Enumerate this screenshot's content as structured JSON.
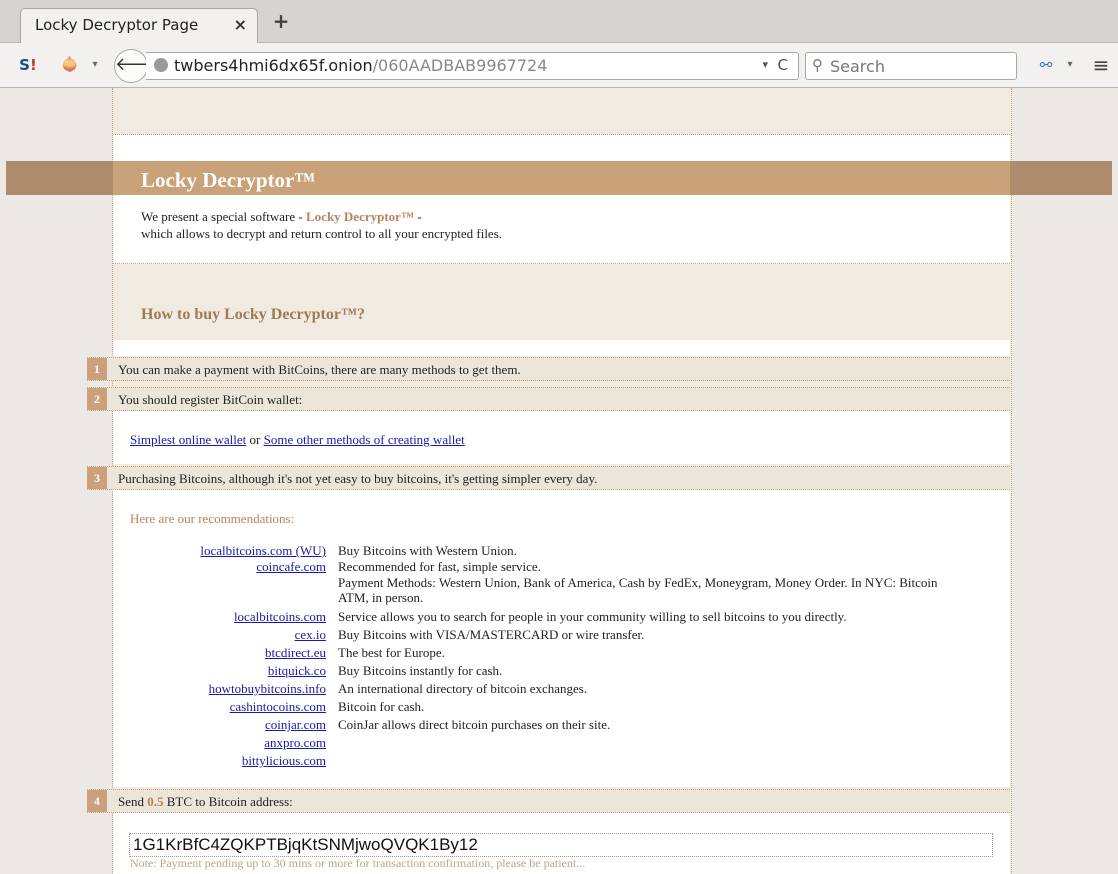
{
  "tab": {
    "title": "Locky Decryptor Page",
    "close": "×",
    "new": "+"
  },
  "toolbar": {
    "ext_left_s": "S",
    "ext_left_bang": "!",
    "onion": "🧅",
    "dropdown": "▾",
    "back": "🡐",
    "url_host": "twbers4hmi6dx65f.onion",
    "url_path": "/060AADBAB9967724",
    "reload": "C",
    "search_icon": "⚲",
    "search_placeholder": "Search",
    "ext_right": "⚯",
    "menu": "≡"
  },
  "page": {
    "title": "Locky Decryptor™",
    "intro_line1_pre": "We present a special software - ",
    "intro_line1_brand": "Locky Decryptor™",
    "intro_line1_post": " -",
    "intro_line2": "which allows to decrypt and return control to all your encrypted files.",
    "howto": "How to buy Locky Decryptor™?",
    "steps": [
      {
        "num": "1",
        "text": "You can make a payment with BitCoins, there are many methods to get them."
      },
      {
        "num": "2",
        "text": "You should register BitCoin wallet:"
      },
      {
        "num": "3",
        "text": "Purchasing Bitcoins, although it's not yet easy to buy bitcoins, it's getting simpler every day."
      },
      {
        "num": "4",
        "text_pre": "Send ",
        "amount": "0.5",
        "text_post": " BTC to Bitcoin address:"
      }
    ],
    "wallet_link1": "Simplest online wallet",
    "wallet_or": " or ",
    "wallet_link2": "Some other methods of creating wallet",
    "recommendations": "Here are our recommendations:",
    "vendors": [
      {
        "name": "localbitcoins.com (WU)",
        "desc": "Buy Bitcoins with Western Union."
      },
      {
        "name": "coincafe.com",
        "desc": "Recommended for fast, simple service.",
        "desc2": "Payment Methods: Western Union, Bank of America, Cash by FedEx, Moneygram, Money Order. In NYC: Bitcoin ATM, in person."
      },
      {
        "name": "localbitcoins.com",
        "desc": "Service allows you to search for people in your community willing to sell bitcoins to you directly."
      },
      {
        "name": "cex.io",
        "desc": "Buy Bitcoins with VISA/MASTERCARD or wire transfer."
      },
      {
        "name": "btcdirect.eu",
        "desc": "The best for Europe."
      },
      {
        "name": "bitquick.co",
        "desc": "Buy Bitcoins instantly for cash."
      },
      {
        "name": "howtobuybitcoins.info",
        "desc": "An international directory of bitcoin exchanges."
      },
      {
        "name": "cashintocoins.com",
        "desc": "Bitcoin for cash."
      },
      {
        "name": "coinjar.com",
        "desc": "CoinJar allows direct bitcoin purchases on their site."
      },
      {
        "name": "anxpro.com",
        "desc": ""
      },
      {
        "name": "bittylicious.com",
        "desc": ""
      }
    ],
    "btc_address": "1G1KrBfC4ZQKPTBjqKtSNMjwoQVQK1By12",
    "note": "Note: Payment pending up to 30 mins or more for transaction confirmation, please be patient..."
  }
}
